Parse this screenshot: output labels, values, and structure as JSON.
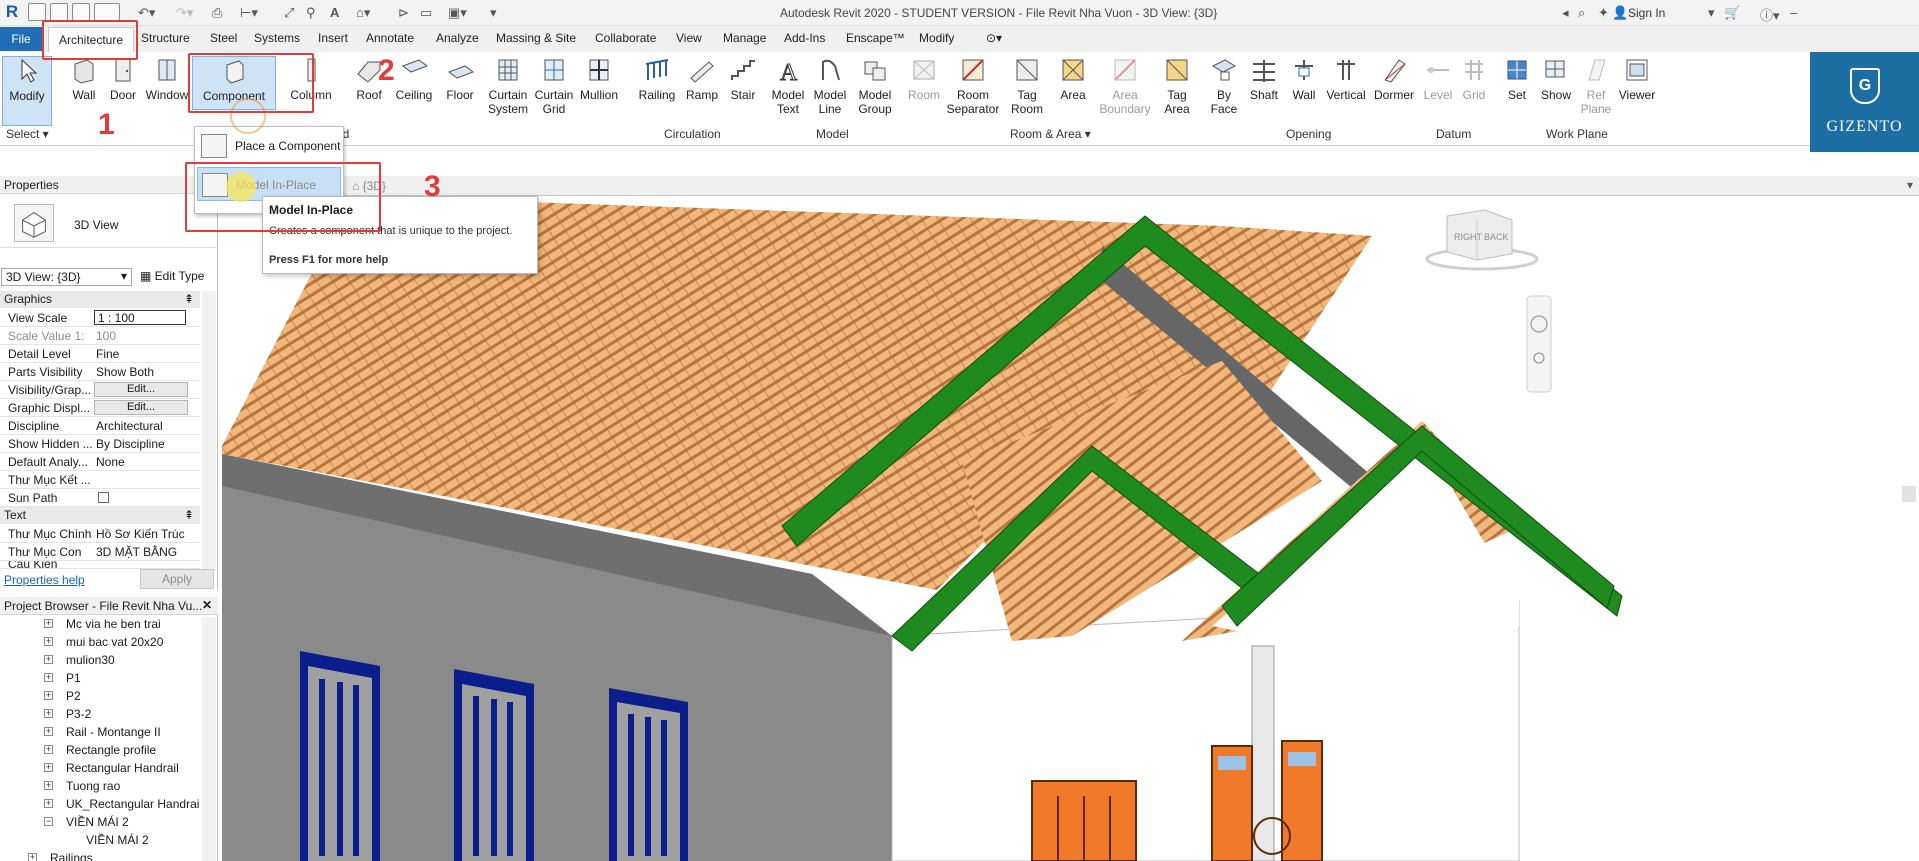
{
  "titlebar": {
    "title": "Autodesk Revit 2020 - STUDENT VERSION - File Revit Nha Vuon - 3D View: {3D}",
    "sign_in": "Sign In"
  },
  "tabs": [
    "File",
    "Architecture",
    "Structure",
    "Steel",
    "Systems",
    "Insert",
    "Annotate",
    "Analyze",
    "Massing & Site",
    "Collaborate",
    "View",
    "Manage",
    "Add-Ins",
    "Enscape™",
    "Modify"
  ],
  "ribbon": {
    "select": {
      "modify": "Modify",
      "panel": "Select ▾"
    },
    "build": {
      "wall": "Wall",
      "door": "Door",
      "window": "Window",
      "component": "Component",
      "column": "Column",
      "roof": "Roof",
      "ceiling": "Ceiling",
      "floor": "Floor",
      "curtain_system_1": "Curtain",
      "curtain_system_2": "System",
      "curtain_grid_1": "Curtain",
      "curtain_grid_2": "Grid",
      "mullion": "Mullion",
      "panel_tail": "ld"
    },
    "circulation": {
      "railing": "Railing",
      "ramp": "Ramp",
      "stair": "Stair",
      "panel": "Circulation"
    },
    "model": {
      "text_1": "Model",
      "text_2": "Text",
      "line_1": "Model",
      "line_2": "Line",
      "group_1": "Model",
      "group_2": "Group",
      "panel": "Model"
    },
    "room": {
      "room": "Room",
      "sep_1": "Room",
      "sep_2": "Separator",
      "tag_1": "Tag",
      "tag_2": "Room",
      "area": "Area",
      "ab_1": "Area",
      "ab_2": "Boundary",
      "ta_1": "Tag",
      "ta_2": "Area",
      "panel": "Room & Area ▾"
    },
    "opening": {
      "byface_1": "By",
      "byface_2": "Face",
      "shaft": "Shaft",
      "wall": "Wall",
      "vertical": "Vertical",
      "dormer": "Dormer",
      "panel": "Opening"
    },
    "datum": {
      "level": "Level",
      "grid": "Grid",
      "panel": "Datum"
    },
    "workplane": {
      "set": "Set",
      "show": "Show",
      "ref_1": "Ref",
      "ref_2": "Plane",
      "viewer": "Viewer",
      "panel": "Work Plane"
    }
  },
  "brand": {
    "name": "GIZENTO",
    "letter": "G"
  },
  "steps": [
    "1",
    "2",
    "3"
  ],
  "dropdown": {
    "place_component": "Place a Component",
    "model_in_place": "Model In-Place"
  },
  "tooltip": {
    "title": "Model In-Place",
    "description": "Creates a component that is unique to the project.",
    "help": "Press F1 for more help"
  },
  "properties": {
    "header": "Properties",
    "type_name": "3D View",
    "view_selector": "3D View: {3D}",
    "edit_type": "Edit Type",
    "groups": {
      "graphics": "Graphics",
      "text": "Text"
    },
    "rows": [
      {
        "k": "View Scale",
        "v": "1 : 100"
      },
      {
        "k": "Scale Value    1:",
        "v": "100"
      },
      {
        "k": "Detail Level",
        "v": "Fine"
      },
      {
        "k": "Parts Visibility",
        "v": "Show Both"
      },
      {
        "k": "Visibility/Grap...",
        "v": "Edit..."
      },
      {
        "k": "Graphic Displ...",
        "v": "Edit..."
      },
      {
        "k": "Discipline",
        "v": "Architectural"
      },
      {
        "k": "Show Hidden ...",
        "v": "By Discipline"
      },
      {
        "k": "Default Analy...",
        "v": "None"
      },
      {
        "k": "Thư Mục Kết ...",
        "v": ""
      },
      {
        "k": "Sun Path",
        "v": ""
      }
    ],
    "text_rows": [
      {
        "k": "Thư Mục Chính",
        "v": "Hồ Sơ Kiến Trúc"
      },
      {
        "k": "Thư Mục Con",
        "v": "3D MẶT BẰNG"
      },
      {
        "k": "Cấu Kiện",
        "v": ""
      }
    ],
    "help_link": "Properties help",
    "apply": "Apply"
  },
  "browser": {
    "header": "Project Browser - File Revit Nha Vu...",
    "items": [
      "Mc via he ben trai",
      "mui bac vat 20x20",
      "mulion30",
      "P1",
      "P2",
      "P3-2",
      "Rail - Montange II",
      "Rectangle profile",
      "Rectangular Handrail",
      "Tuong rao",
      "UK_Rectangular Handrai",
      "VIỀN MÁI 2",
      "VIỀN MÁI 2",
      "Railings"
    ]
  },
  "view": {
    "tab_label": "{3D}",
    "viewcube_right": "RIGHT",
    "viewcube_back": "BACK"
  },
  "colors": {
    "accent": "#1f6db5",
    "highlight": "#e23b3b",
    "roof_tile": "#e8a866",
    "ridge": "#1e8a1e",
    "window_frame": "#0b1e8c",
    "door": "#f07a2a"
  }
}
